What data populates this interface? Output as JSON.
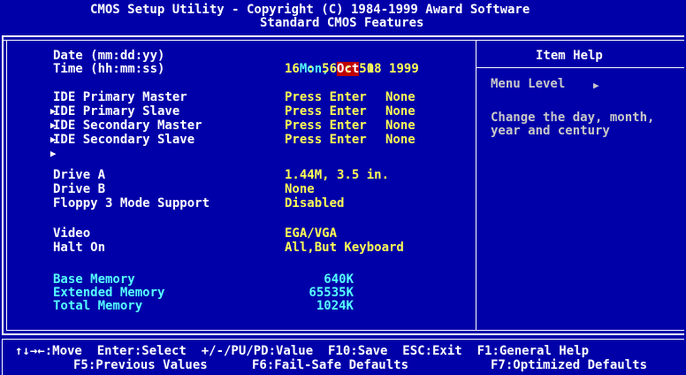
{
  "header": {
    "line1": "CMOS Setup Utility - Copyright (C) 1984-1999 Award Software",
    "line2": "Standard CMOS Features"
  },
  "date": {
    "label": "Date (mm:dd:yy)",
    "weekday": "Mon,",
    "month": "Oct",
    "day": "18",
    "year": "1999"
  },
  "time": {
    "label": "Time (hh:mm:ss)",
    "value": "16 : 56 : 50"
  },
  "ide": [
    {
      "label": "IDE Primary Master",
      "action": "Press Enter",
      "value": "None"
    },
    {
      "label": "IDE Primary Slave",
      "action": "Press Enter",
      "value": "None"
    },
    {
      "label": "IDE Secondary Master",
      "action": "Press Enter",
      "value": "None"
    },
    {
      "label": "IDE Secondary Slave",
      "action": "Press Enter",
      "value": "None"
    }
  ],
  "drives": [
    {
      "label": "Drive A",
      "value": "1.44M, 3.5 in."
    },
    {
      "label": "Drive B",
      "value": "None"
    },
    {
      "label": "Floppy 3 Mode Support",
      "value": "Disabled"
    }
  ],
  "display": [
    {
      "label": "Video",
      "value": "EGA/VGA"
    },
    {
      "label": "Halt On",
      "value": "All,But Keyboard"
    }
  ],
  "memory": [
    {
      "label": "Base Memory",
      "value": "640K"
    },
    {
      "label": "Extended Memory",
      "value": "65535K"
    },
    {
      "label": "Total Memory",
      "value": "1024K"
    }
  ],
  "help": {
    "title": "Item Help",
    "menu_level": "Menu Level",
    "menu_level_marker": "▶",
    "text_line1": "Change the day, month,",
    "text_line2": "year and century"
  },
  "footer": {
    "line1": "↑↓→←:Move  Enter:Select  +/-/PU/PD:Value  F10:Save  ESC:Exit  F1:General Help",
    "line2_left": "F5:Previous Values",
    "line2_mid": "F6:Fail-Safe Defaults",
    "line2_right": "F7:Optimized Defaults"
  },
  "colors": {
    "background": "#0000a8",
    "label": "#ffffff",
    "value": "#ffff55",
    "readonly": "#55ffff",
    "highlight": "#c00000"
  }
}
